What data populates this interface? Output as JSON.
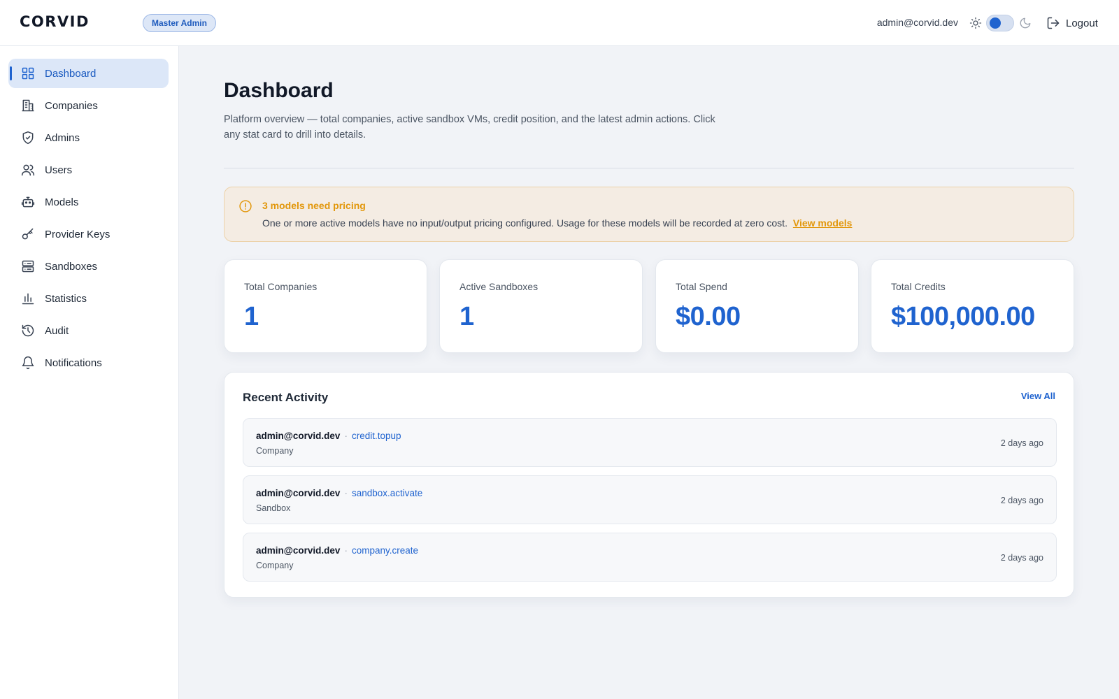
{
  "header": {
    "brand": "CORVID",
    "role_badge": "Master Admin",
    "user_email": "admin@corvid.dev",
    "logout_label": "Logout",
    "theme_toggle": "light"
  },
  "sidebar": {
    "items": [
      {
        "label": "Dashboard",
        "icon": "grid-icon",
        "active": true
      },
      {
        "label": "Companies",
        "icon": "building-icon"
      },
      {
        "label": "Admins",
        "icon": "shield-icon"
      },
      {
        "label": "Users",
        "icon": "users-icon"
      },
      {
        "label": "Models",
        "icon": "robot-icon"
      },
      {
        "label": "Provider Keys",
        "icon": "key-icon"
      },
      {
        "label": "Sandboxes",
        "icon": "server-icon"
      },
      {
        "label": "Statistics",
        "icon": "bar-chart-icon"
      },
      {
        "label": "Audit",
        "icon": "history-icon"
      },
      {
        "label": "Notifications",
        "icon": "bell-icon"
      }
    ]
  },
  "main": {
    "title": "Dashboard",
    "description": "Platform overview — total companies, active sandbox VMs, credit position, and the latest admin actions. Click any stat card to drill into details.",
    "alert": {
      "title": "3 models need pricing",
      "text": "One or more active models have no input/output pricing configured. Usage for these models will be recorded at zero cost.",
      "link": "View models"
    },
    "stats": [
      {
        "label": "Total Companies",
        "value": "1"
      },
      {
        "label": "Active Sandboxes",
        "value": "1"
      },
      {
        "label": "Total Spend",
        "value": "$0.00"
      },
      {
        "label": "Total Credits",
        "value": "$100,000.00"
      }
    ],
    "activity": {
      "title": "Recent Activity",
      "view_all": "View All",
      "rows": [
        {
          "user": "admin@corvid.dev",
          "action": "credit.topup",
          "entity": "Company",
          "time": "2 days ago"
        },
        {
          "user": "admin@corvid.dev",
          "action": "sandbox.activate",
          "entity": "Sandbox",
          "time": "2 days ago"
        },
        {
          "user": "admin@corvid.dev",
          "action": "company.create",
          "entity": "Company",
          "time": "2 days ago"
        }
      ]
    }
  },
  "colors": {
    "accent": "#1f63cf",
    "warning": "#e2970b",
    "background": "#f1f3f7"
  }
}
